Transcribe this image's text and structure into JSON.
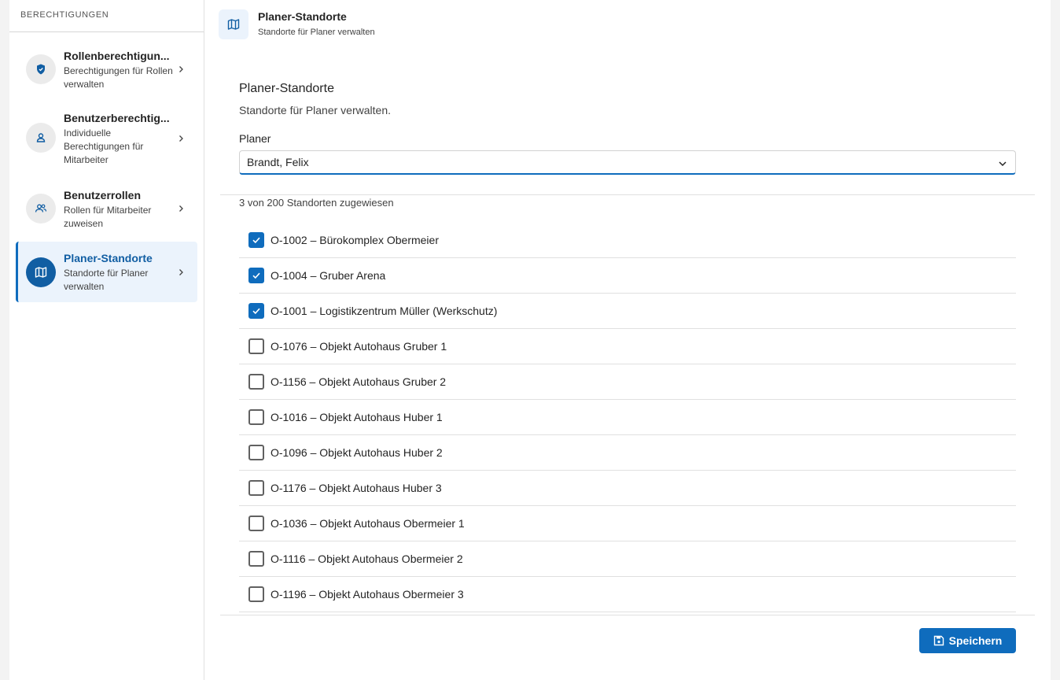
{
  "sidebar": {
    "header": "BERECHTIGUNGEN",
    "items": [
      {
        "title": "Rollenberechtigun...",
        "desc": "Berechtigungen für Rollen verwalten",
        "icon": "shield-icon"
      },
      {
        "title": "Benutzerberechtig...",
        "desc": "Individuelle Berechtigungen für Mitarbeiter",
        "icon": "person-icon"
      },
      {
        "title": "Benutzerrollen",
        "desc": "Rollen für Mitarbeiter zuweisen",
        "icon": "people-icon"
      },
      {
        "title": "Planer-Standorte",
        "desc": "Standorte für Planer verwalten",
        "icon": "map-icon",
        "active": true
      }
    ]
  },
  "header": {
    "title": "Planer-Standorte",
    "subtitle": "Standorte für Planer verwalten",
    "icon": "map-icon"
  },
  "section": {
    "title": "Planer-Standorte",
    "description": "Standorte für Planer verwalten."
  },
  "planer": {
    "label": "Planer",
    "value": "Brandt, Felix"
  },
  "count_text": "3 von 200 Standorten zugewiesen",
  "locations": [
    {
      "label": "O-1002 – Bürokomplex Obermeier",
      "checked": true
    },
    {
      "label": "O-1004 – Gruber Arena",
      "checked": true
    },
    {
      "label": "O-1001 – Logistikzentrum Müller (Werkschutz)",
      "checked": true
    },
    {
      "label": "O-1076 – Objekt Autohaus Gruber 1",
      "checked": false
    },
    {
      "label": "O-1156 – Objekt Autohaus Gruber 2",
      "checked": false
    },
    {
      "label": "O-1016 – Objekt Autohaus Huber 1",
      "checked": false
    },
    {
      "label": "O-1096 – Objekt Autohaus Huber 2",
      "checked": false
    },
    {
      "label": "O-1176 – Objekt Autohaus Huber 3",
      "checked": false
    },
    {
      "label": "O-1036 – Objekt Autohaus Obermeier 1",
      "checked": false
    },
    {
      "label": "O-1116 – Objekt Autohaus Obermeier 2",
      "checked": false
    },
    {
      "label": "O-1196 – Objekt Autohaus Obermeier 3",
      "checked": false
    }
  ],
  "save_label": "Speichern",
  "colors": {
    "accent": "#0f6cbd",
    "active_bg": "#ebf3fc"
  }
}
